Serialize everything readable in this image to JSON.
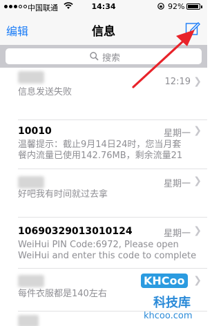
{
  "status_bar": {
    "carrier": "中国联通",
    "time": "14:34",
    "battery_percent": "92%",
    "battery_level": 0.92
  },
  "nav": {
    "edit_label": "编辑",
    "title": "信息",
    "compose_icon": "compose-icon"
  },
  "search": {
    "placeholder": "搜索"
  },
  "messages": [
    {
      "sender": "",
      "sender_hidden": true,
      "time": "12:19",
      "preview_lines": [
        "信息发送失败"
      ]
    },
    {
      "sender": "10010",
      "sender_hidden": false,
      "time": "星期一",
      "preview_lines": [
        "温馨提示：截止9月14日24时，您当月套",
        "餐内流量已使用142.76MB，剩余流量21"
      ]
    },
    {
      "sender": "",
      "sender_hidden": true,
      "time": "星期一",
      "preview_lines": [
        "好吧我有时间就过去拿"
      ]
    },
    {
      "sender": "10690329013010124",
      "sender_hidden": false,
      "time": "星期一",
      "preview_lines": [
        "WeiHui PIN Code:6972, Please open",
        "WeiHui and enter this code to complete"
      ]
    },
    {
      "sender": "",
      "sender_hidden": true,
      "time": "",
      "preview_lines": [
        "每件衣服都是140左右"
      ]
    }
  ],
  "watermark": {
    "logo": "KHCoo",
    "brand": "科技库",
    "domain": "khcoo.com"
  },
  "colors": {
    "accent": "#1a7cf7",
    "arrow": "#e8232a",
    "secondary_text": "#8e8e93"
  }
}
